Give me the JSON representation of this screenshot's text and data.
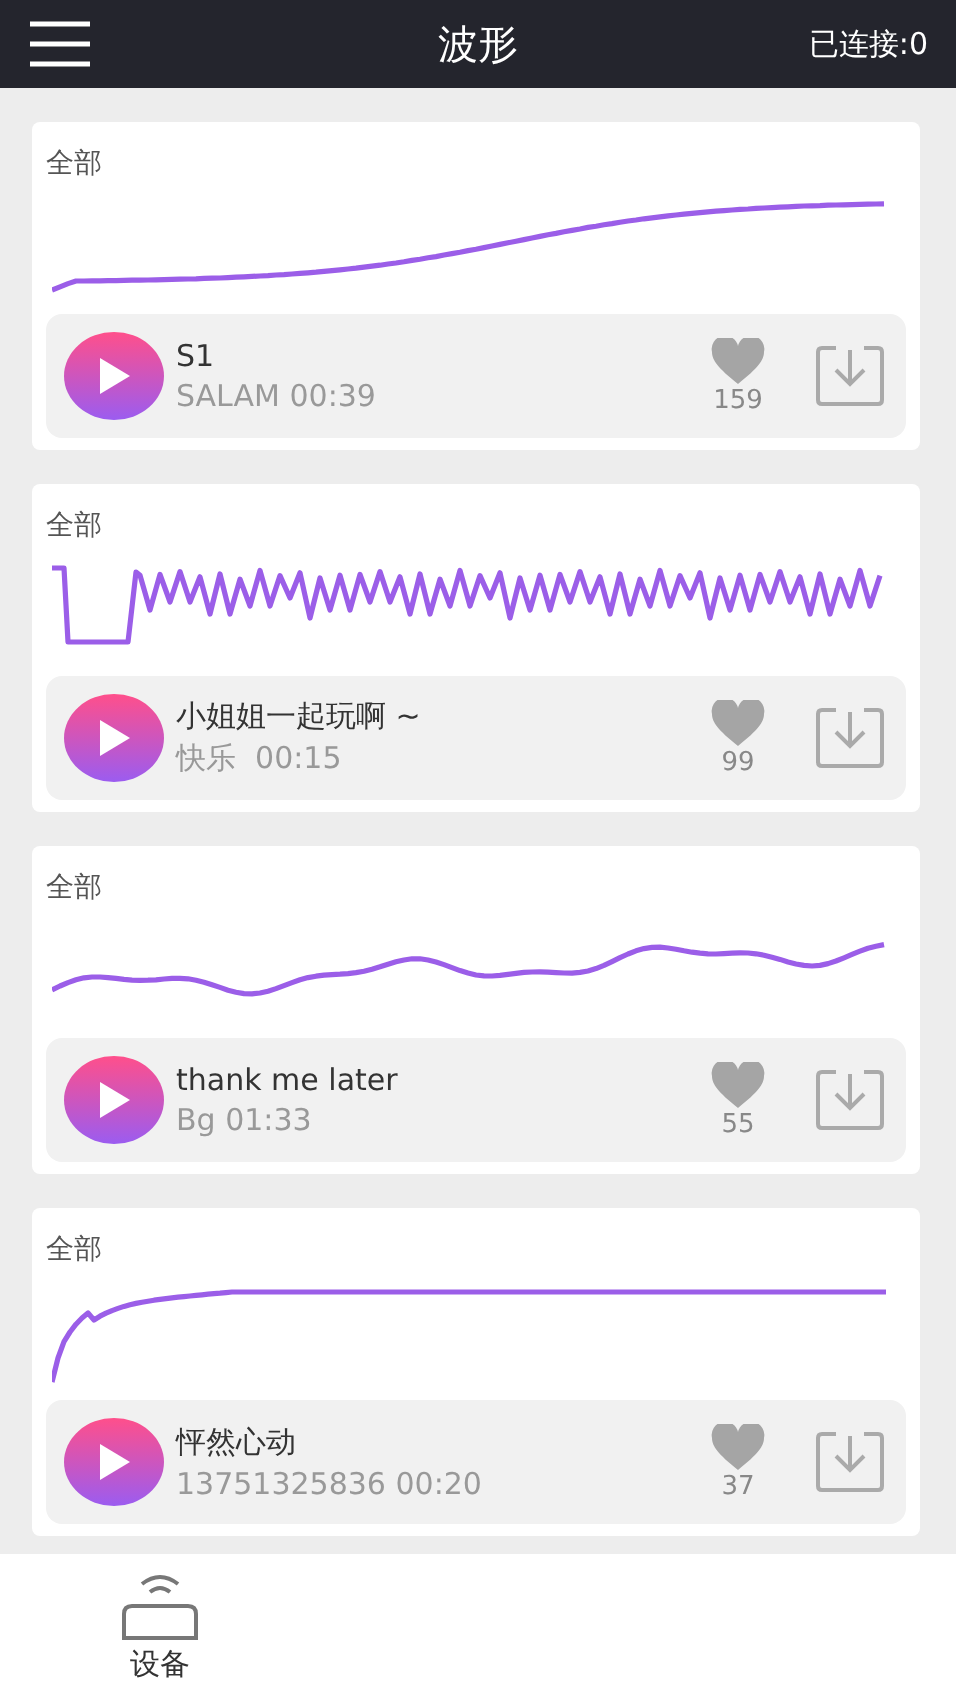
{
  "header": {
    "title": "波形",
    "status": "已连接:0"
  },
  "cards": [
    {
      "label": "全部",
      "kind": "rising",
      "title": "S1",
      "subtitle": "SALAM 00:39",
      "likes": "159"
    },
    {
      "label": "全部",
      "kind": "zigzag",
      "title": "小姐姐一起玩啊 ~",
      "subtitle": "快乐  00:15",
      "likes": "99"
    },
    {
      "label": "全部",
      "kind": "wavy",
      "title": "thank me later",
      "subtitle": "Bg 01:33",
      "likes": "55"
    },
    {
      "label": "全部",
      "kind": "saturating",
      "title": "怦然心动",
      "subtitle": "13751325836 00:20",
      "likes": "37"
    }
  ],
  "bottom_nav": [
    {
      "label": "设备",
      "selected": true
    }
  ]
}
